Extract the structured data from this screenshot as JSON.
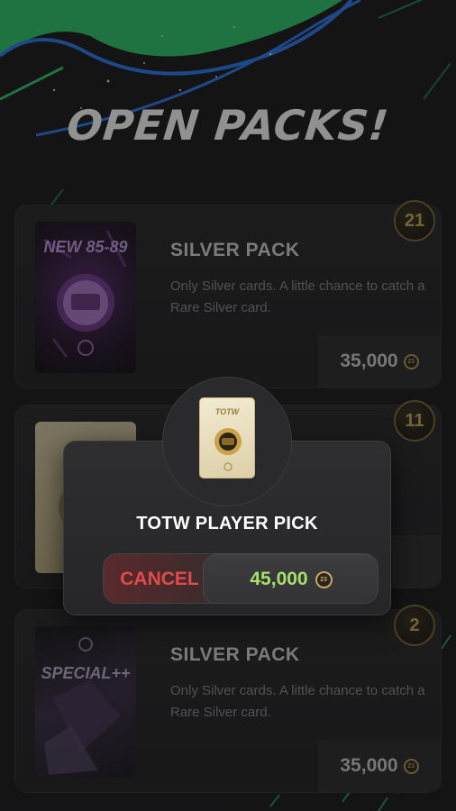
{
  "header": {
    "title": "OPEN PACKS!"
  },
  "packs": [
    {
      "art_label": "NEW 85-89",
      "name": "SILVER PACK",
      "description": "Only Silver cards. A little chance to catch a Rare Silver card.",
      "price": "35,000",
      "count": "21"
    },
    {
      "art_label": "",
      "name": "",
      "description": "",
      "price": "",
      "count": "11"
    },
    {
      "art_label": "SPECIAL++",
      "name": "SILVER PACK",
      "description": "Only Silver cards. A little chance to catch a Rare Silver card.",
      "price": "35,000",
      "count": "2"
    }
  ],
  "dialog": {
    "pack_art_label": "TOTW",
    "title": "TOTW PLAYER PICK",
    "cancel_label": "CANCEL",
    "price": "45,000"
  },
  "coin": {
    "label": "23"
  },
  "colors": {
    "accent_green": "#3fd47a",
    "accent_blue": "#2f7cf0",
    "price_green": "#a6e06a",
    "cancel_red": "#e34a4e",
    "gold": "#c9ab63"
  }
}
